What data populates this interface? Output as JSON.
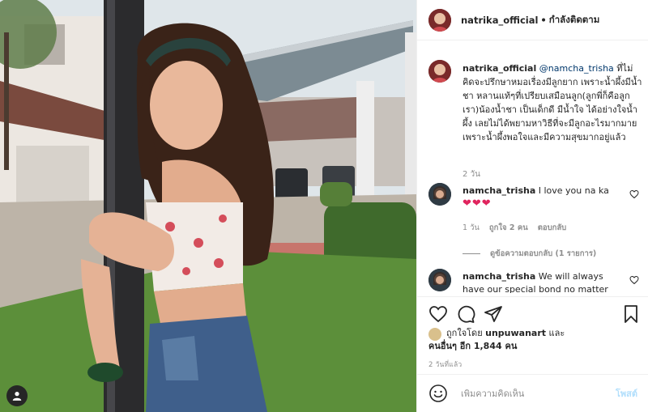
{
  "post": {
    "username": "natrika_official",
    "dot": "•",
    "follow_status": "กำลังติดตาม",
    "caption": {
      "username": "natrika_official",
      "mention": "@namcha_trisha",
      "text": " ที่ไม่คิดจะปรึกษาหมอเรื่องมีลูกยาก เพราะน้ำผึ้งมีน้ำชา หลานแท้ๆที่เปรียบเสมือนลูก(ลูกพี่ก็คือลูกเรา)น้องน้ำชา เป็นเด็กดี มีน้ำใจ ได้อย่างใจน้ำผึ้ง เลยไม่ได้พยามหาวิธีที่จะมีลูกอะไรมากมาย เพราะน้ำผึ้งพอใจและมีความสุขมากอยู่แล้ว",
      "time": "2 วัน"
    },
    "comments": [
      {
        "username": "namcha_trisha",
        "text": "I love you na ka",
        "emoji": "❤❤❤",
        "time": "1 วัน",
        "likes": "ถูกใจ 2 คน",
        "reply": "ตอบกลับ",
        "view_replies": "ดูข้อความตอบกลับ (1 รายการ)"
      },
      {
        "username": "namcha_trisha",
        "text": "We will always have our special bond no matter"
      }
    ],
    "likes": {
      "prefix": "ถูกใจโดย",
      "liker": "unpuwanart",
      "and": "และ",
      "others": "คนอื่นๆ อีก 1,844 คน"
    },
    "posted_time": "2 วันที่แล้ว",
    "add_comment": {
      "placeholder": "เพิ่มความคิดเห็น",
      "post_label": "โพสต์"
    }
  },
  "colors": {
    "link": "#00376b",
    "muted": "#8e8e8e",
    "post_button_disabled": "#b2dffc",
    "heart": "#e0245e"
  },
  "icons": [
    "user-tag-icon",
    "heart-icon",
    "comment-icon",
    "share-icon",
    "bookmark-icon",
    "smile-icon",
    "small-heart-icon"
  ]
}
